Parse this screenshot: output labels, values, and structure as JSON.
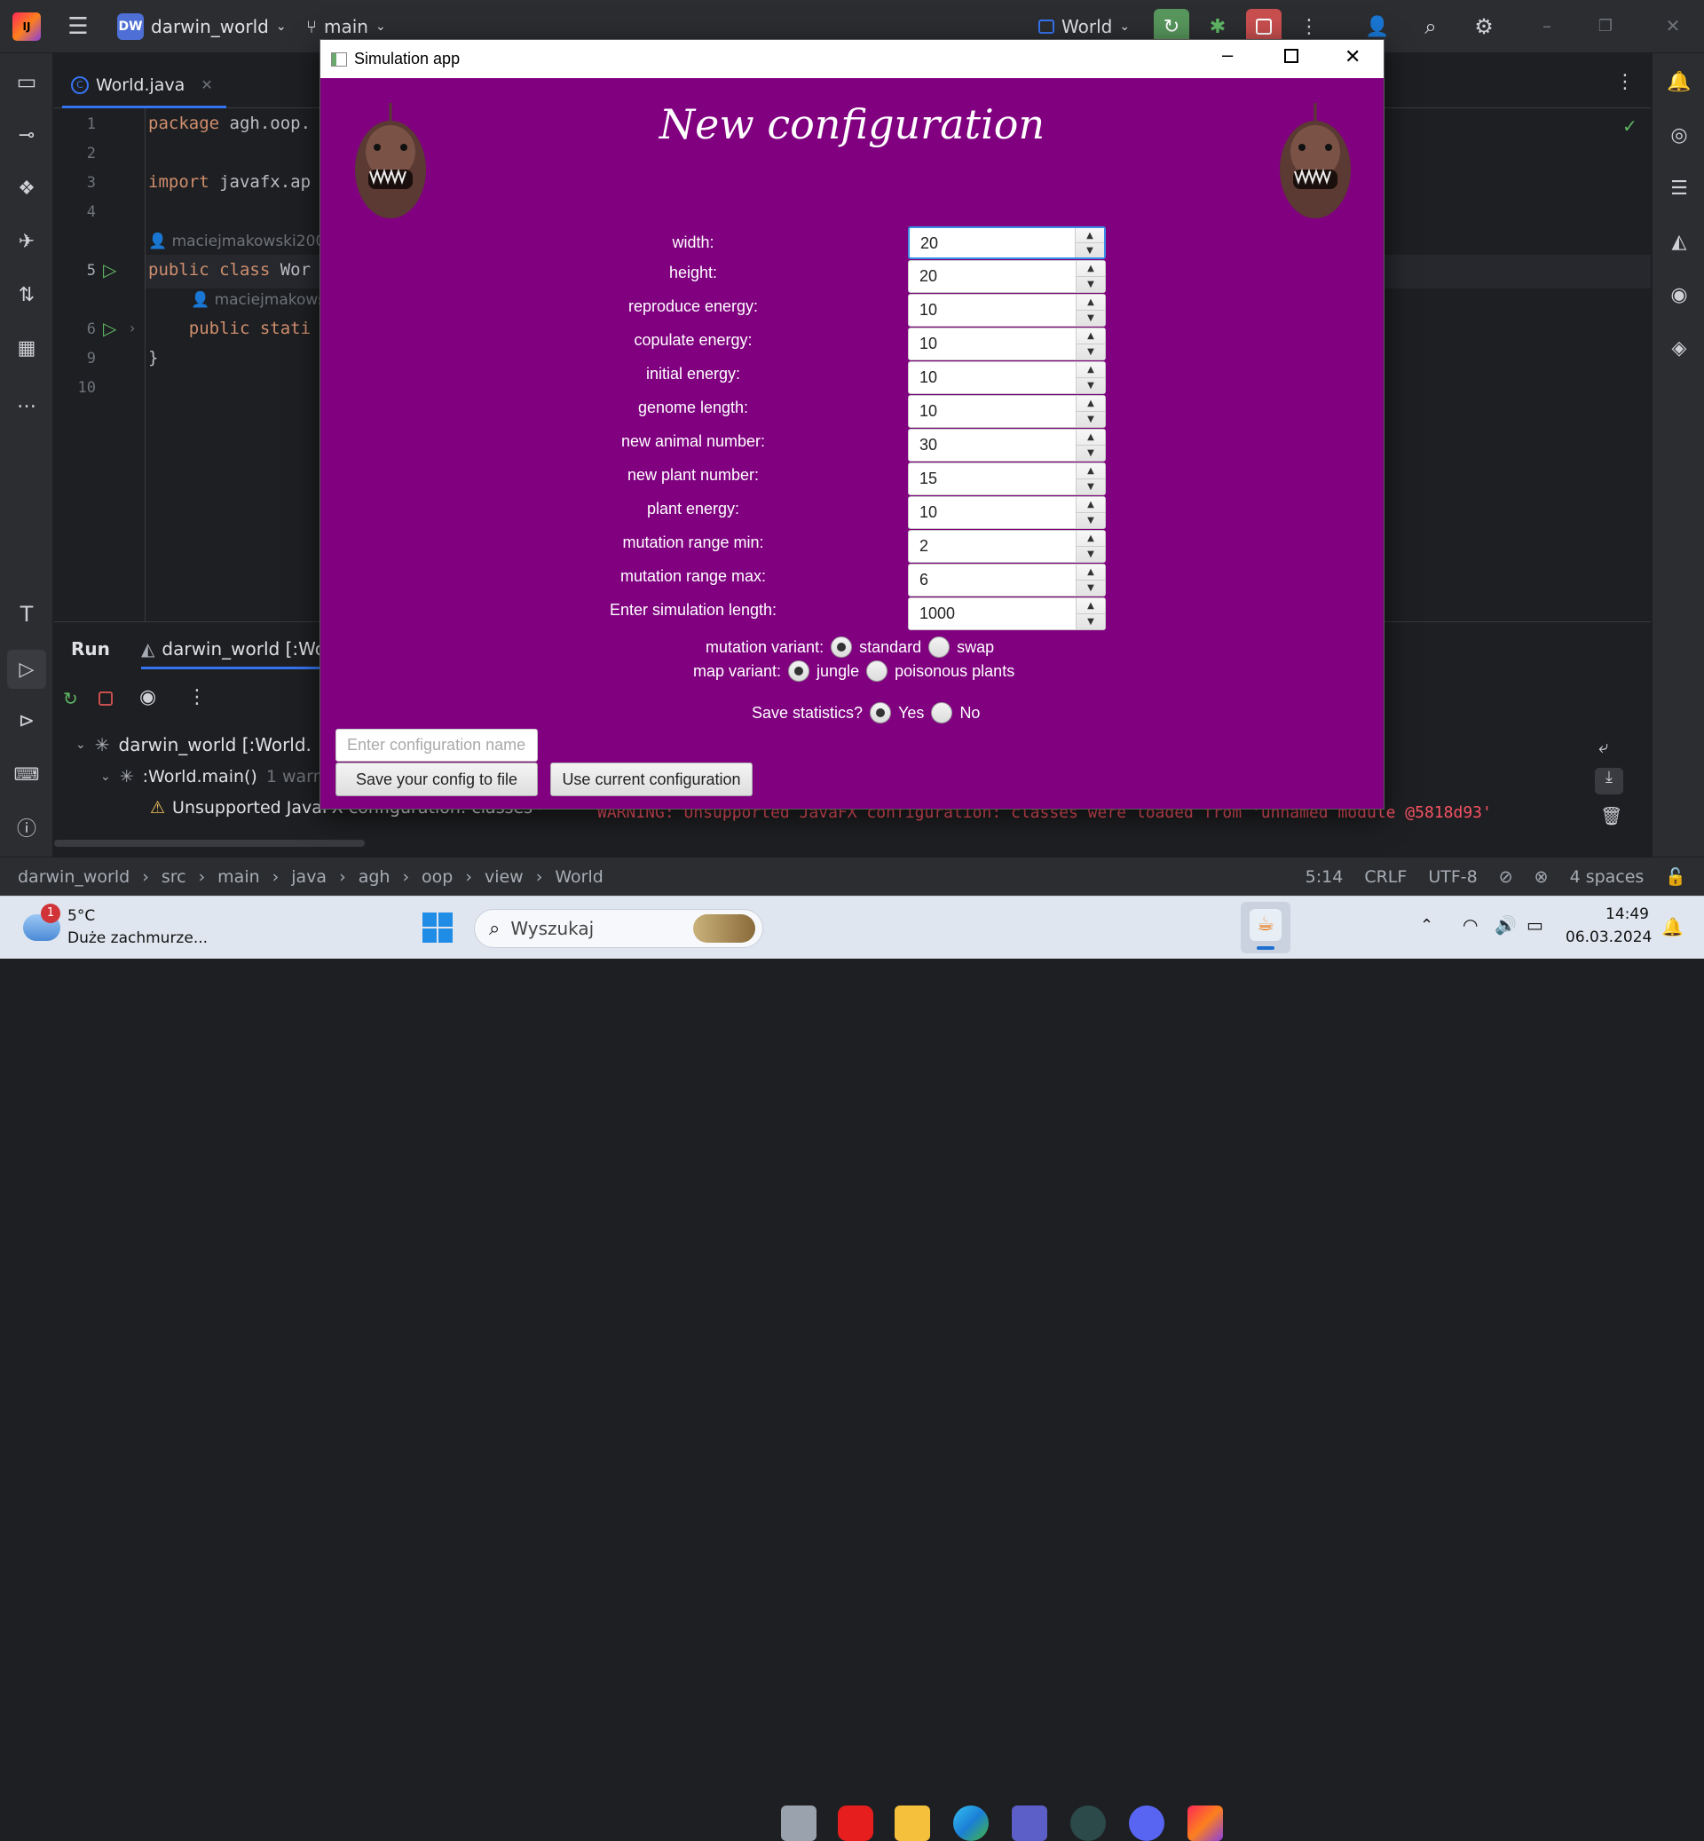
{
  "ide": {
    "project_badge": "DW",
    "project_name": "darwin_world",
    "branch": "main",
    "run_config": "World",
    "editor_tab": "World.java",
    "code_lines": [
      {
        "num": "1",
        "text": "package agh.oop."
      },
      {
        "num": "2",
        "text": ""
      },
      {
        "num": "3",
        "text": "import javafx.ap"
      },
      {
        "num": "4",
        "text": ""
      },
      {
        "num": "5",
        "text": "public class Wor"
      },
      {
        "num": "6",
        "text": "    public stati"
      },
      {
        "num": "9",
        "text": "}"
      },
      {
        "num": "10",
        "text": ""
      }
    ],
    "author_1": "maciejmakowski200",
    "author_2": "maciejmakows",
    "run_tab": "Run",
    "run_config_tab": "darwin_world [:Wo",
    "tree_root": "darwin_world [:World.",
    "tree_child": ":World.main()",
    "tree_child_suffix": "1 warn",
    "warning_text": "Unsupported JavaFX configuration: classes were l",
    "console_warning": "WARNING: Unsupported JavaFX configuration: classes were loaded from 'unnamed module @5818d93'",
    "breadcrumbs": [
      "darwin_world",
      "src",
      "main",
      "java",
      "agh",
      "oop",
      "view",
      "World"
    ],
    "status": {
      "position": "5:14",
      "line_sep": "CRLF",
      "encoding": "UTF-8",
      "indent": "4 spaces"
    }
  },
  "dialog": {
    "window_title": "Simulation app",
    "heading": "New configuration",
    "fields": [
      {
        "label": "width:",
        "value": "20"
      },
      {
        "label": "height:",
        "value": "20"
      },
      {
        "label": "reproduce energy:",
        "value": "10"
      },
      {
        "label": "copulate energy:",
        "value": "10"
      },
      {
        "label": "initial energy:",
        "value": "10"
      },
      {
        "label": "genome length:",
        "value": "10"
      },
      {
        "label": "new animal number:",
        "value": "30"
      },
      {
        "label": "new plant number:",
        "value": "15"
      },
      {
        "label": "plant energy:",
        "value": "10"
      },
      {
        "label": "mutation range min:",
        "value": "2"
      },
      {
        "label": "mutation range max:",
        "value": "6"
      },
      {
        "label": "Enter simulation length:",
        "value": "1000"
      }
    ],
    "mutation_variant": {
      "label": "mutation variant:",
      "options": [
        "standard",
        "swap"
      ],
      "selected": "standard"
    },
    "map_variant": {
      "label": "map variant:",
      "options": [
        "jungle",
        "poisonous plants"
      ],
      "selected": "jungle"
    },
    "save_stats": {
      "label": "Save statistics?",
      "options": [
        "Yes",
        "No"
      ],
      "selected": "Yes"
    },
    "config_name_placeholder": "Enter configuration name",
    "save_button": "Save your config to file",
    "use_button": "Use current configuration"
  },
  "taskbar": {
    "weather_temp": "5°C",
    "weather_desc": "Duże zachmurze...",
    "weather_badge": "1",
    "search_placeholder": "Wyszukaj",
    "time": "14:49",
    "date": "06.03.2024"
  },
  "colors": {
    "dialog_bg": "#800080",
    "accent": "#3574f0"
  }
}
